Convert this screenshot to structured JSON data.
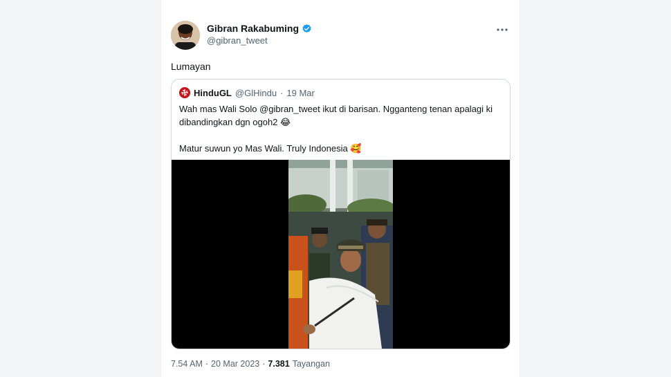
{
  "author": {
    "name": "Gibran Rakabuming",
    "handle": "@gibran_tweet",
    "verified": true,
    "verified_color": "#1d9bf0"
  },
  "more_icon": "more-horizontal-icon",
  "tweet": {
    "text": "Lumayan"
  },
  "quote": {
    "name": "HinduGL",
    "handle": "@GlHindu",
    "separator": "·",
    "date": "19 Mar",
    "lines": [
      "Wah mas Wali Solo @gibran_tweet ikut di barisan. Ngganteng tenan apalagi ki",
      "dibandingkan dgn ogoh2",
      "Matur suwun yo Mas Wali. Truly Indonesia"
    ],
    "emoji_1": "😂",
    "emoji_2": "🥰",
    "avatar_color": "#c4161c"
  },
  "footer": {
    "time": "7.54 AM",
    "separator_1": "·",
    "date": "20 Mar 2023",
    "separator_2": "·",
    "views": "7.381",
    "views_label": "Tayangan"
  }
}
